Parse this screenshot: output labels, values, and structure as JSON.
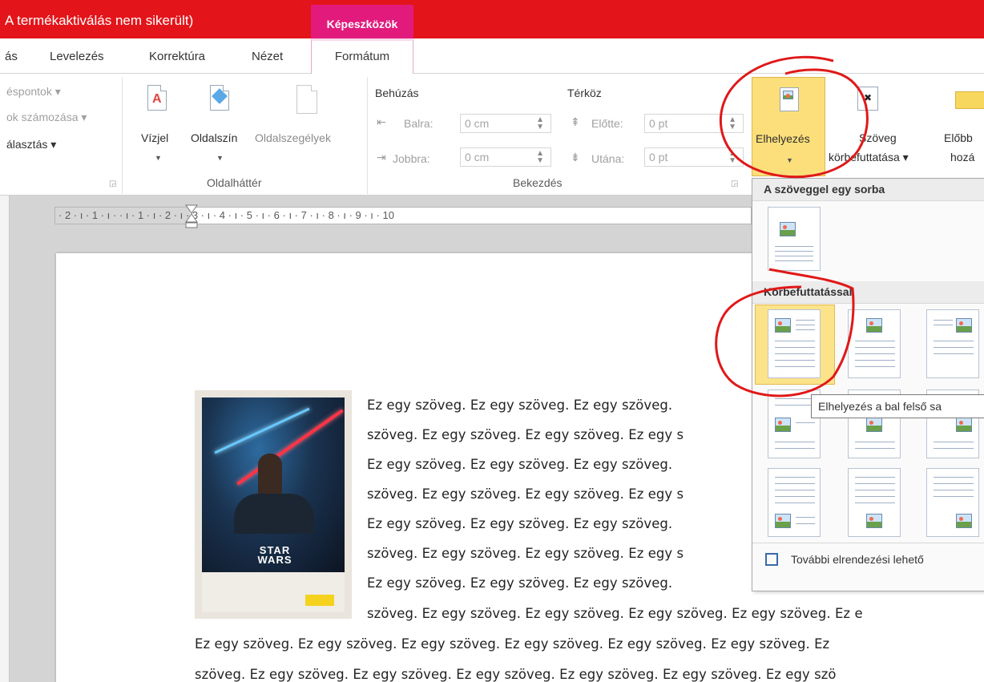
{
  "titlebar": {
    "title": "A termékaktiválás nem sikerült)",
    "context_tab": "Képeszközök"
  },
  "tabs": {
    "partial": "ás",
    "mailings": "Levelezés",
    "review": "Korrektúra",
    "view": "Nézet",
    "format": "Formátum"
  },
  "ribbon": {
    "paragraph_left": {
      "bullets": "éspontok ▾",
      "numbering": "ok számozása ▾",
      "selection": "álasztás ▾"
    },
    "page_background": {
      "watermark": "Vízjel",
      "page_color": "Oldalszín",
      "page_borders": "Oldalszegélyek",
      "group_label": "Oldalháttér"
    },
    "paragraph": {
      "indent_title": "Behúzás",
      "left_label": "Balra:",
      "left_value": "0 cm",
      "right_label": "Jobbra:",
      "right_value": "0 cm",
      "spacing_title": "Térköz",
      "before_label": "Előtte:",
      "before_value": "0 pt",
      "after_label": "Utána:",
      "after_value": "0 pt",
      "group_label": "Bekezdés"
    },
    "arrange": {
      "position": "Elhelyezés",
      "wrap_line1": "Szöveg",
      "wrap_line2": "körbefuttatása ▾",
      "forward_line1": "Előbb",
      "forward_line2": "hozá"
    }
  },
  "ruler": {
    "ticks": "· 2 · ı · 1 · ı ·   · ı · 1 · ı · 2 · ı · 3 · ı · 4 · ı · 5 · ı · 6 · ı · 7 · ı · 8 · ı · 9 · ı · 10"
  },
  "gallery": {
    "inline_header": "A szöveggel egy sorba",
    "wrap_header": "Körbefuttatással",
    "more_options": "További elrendezési lehető"
  },
  "tooltip": "Elhelyezés a bal felső sa",
  "poster": {
    "logo_line1": "STAR",
    "logo_line2": "WARS"
  },
  "document": {
    "lines": [
      "Ez egy szöveg. Ez egy szöveg. Ez egy szöveg.",
      "szöveg. Ez egy szöveg. Ez egy szöveg. Ez egy s",
      "Ez egy szöveg. Ez egy szöveg. Ez egy szöveg.",
      "szöveg. Ez egy szöveg. Ez egy szöveg. Ez egy s",
      "Ez egy szöveg. Ez egy szöveg. Ez egy szöveg.",
      "szöveg. Ez egy szöveg. Ez egy szöveg. Ez egy s",
      "Ez egy szöveg. Ez egy szöveg. Ez egy szöveg.",
      "szöveg. Ez egy szöveg. Ez egy szöveg. Ez egy szöveg. Ez egy szöveg. Ez e",
      "Ez egy szöveg. Ez egy szöveg. Ez egy szöveg. Ez egy szöveg. Ez egy szöveg. Ez egy szöveg. Ez",
      "szöveg. Ez egy szöveg. Ez egy szöveg. Ez egy szöveg. Ez egy szöveg. Ez egy szöveg. Ez egy szö"
    ]
  },
  "colors": {
    "titlebar": "#e3151a",
    "context_tab": "#e21a7c",
    "selected": "#fcdf7b",
    "annotation": "#e01818"
  }
}
